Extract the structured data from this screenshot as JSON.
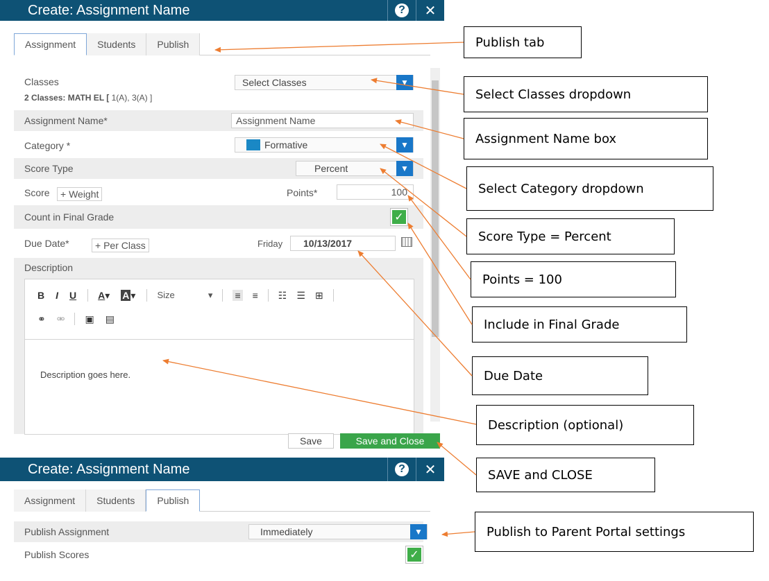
{
  "dialog": {
    "title": "Create: Assignment Name",
    "help_glyph": "?",
    "close_glyph": "✕",
    "tabs": [
      {
        "label": "Assignment",
        "active": true
      },
      {
        "label": "Students",
        "active": false
      },
      {
        "label": "Publish",
        "active": false
      }
    ],
    "form": {
      "classes_label": "Classes",
      "classes_select_value": "Select Classes",
      "classes_summary_bold": "2 Classes: MATH EL [",
      "classes_summary_rest": " 1(A), 3(A) ]",
      "assignment_name_label": "Assignment Name*",
      "assignment_name_value": "Assignment Name",
      "category_label": "Category *",
      "category_value": "Formative",
      "category_color": "#1a88c5",
      "score_type_label": "Score Type",
      "score_type_value": "Percent",
      "score_label": "Score",
      "weight_button": "+ Weight",
      "points_label": "Points*",
      "points_value": "100",
      "count_final_label": "Count in Final Grade",
      "count_final_checked": true,
      "due_date_label": "Due Date*",
      "per_class_button": "+ Per Class",
      "due_day": "Friday",
      "due_date_value": "10/13/2017",
      "description_label": "Description",
      "description_text": "Description goes here.",
      "editor_toolbar": {
        "bold": "B",
        "italic": "I",
        "underline": "U",
        "font_color": "A",
        "bg_color": "A",
        "size_label": "Size"
      }
    },
    "buttons": {
      "save": "Save",
      "save_close": "Save and Close"
    }
  },
  "dialog2": {
    "title": "Create: Assignment Name",
    "help_glyph": "?",
    "close_glyph": "✕",
    "tabs": [
      {
        "label": "Assignment",
        "active": false
      },
      {
        "label": "Students",
        "active": false
      },
      {
        "label": "Publish",
        "active": true
      }
    ],
    "publish_assignment_label": "Publish Assignment",
    "publish_assignment_value": "Immediately",
    "publish_scores_label": "Publish Scores",
    "publish_scores_checked": true
  },
  "callouts": {
    "publish_tab": "Publish tab",
    "select_classes": "Select Classes dropdown",
    "assignment_name": "Assignment Name box",
    "select_category": "Select Category dropdown",
    "score_type": "Score Type = Percent",
    "points": "Points = 100",
    "include_final": "Include in Final Grade",
    "due_date": "Due Date",
    "description": "Description (optional)",
    "save_close": "SAVE and CLOSE",
    "publish_portal": "Publish to Parent Portal settings"
  },
  "colors": {
    "titlebar": "#0e5275",
    "dropdown_chevron": "#1977c8",
    "check_green": "#3fae49",
    "save_close_green": "#3aa54a",
    "arrow_orange": "#ed7d31"
  }
}
